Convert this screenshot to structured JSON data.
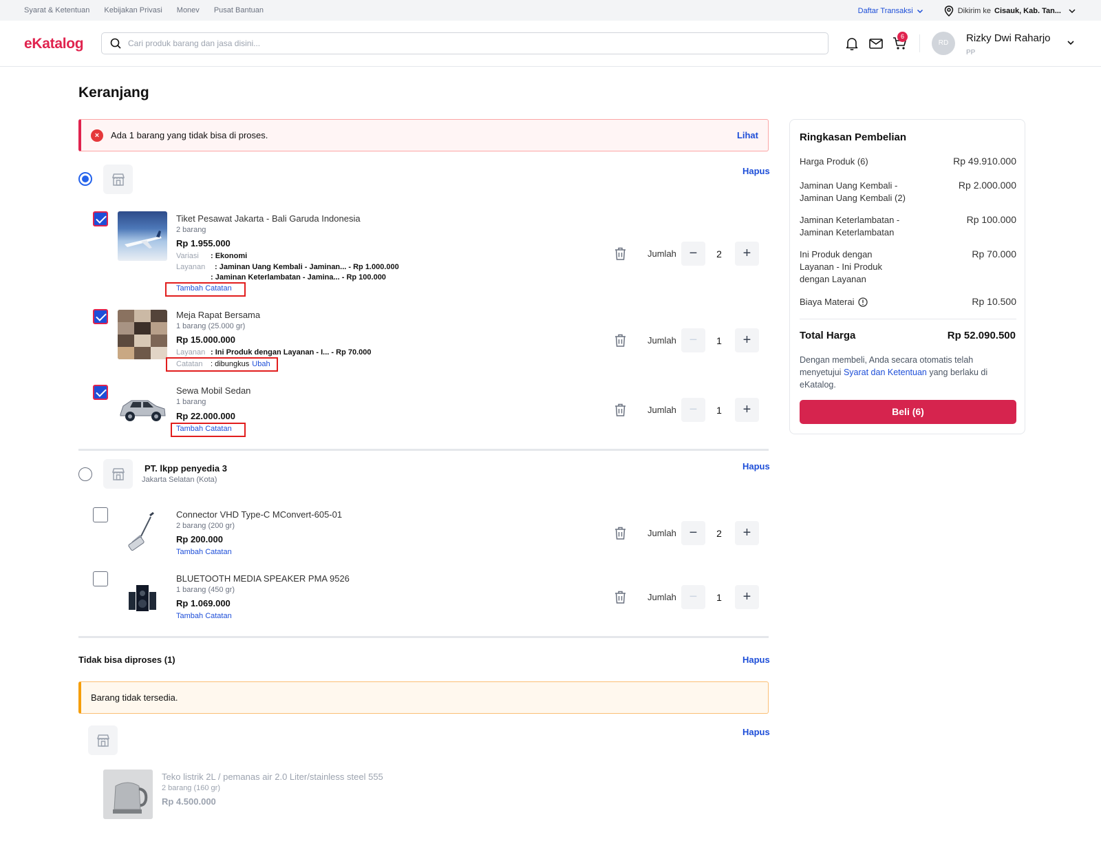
{
  "topbar": {
    "links": [
      "Syarat & Ketentuan",
      "Kebijakan Privasi",
      "Monev",
      "Pusat Bantuan"
    ],
    "daftar_transaksi": "Daftar Transaksi",
    "dikirim_label": "Dikirim ke",
    "dikirim_value": "Cisauk, Kab. Tan..."
  },
  "header": {
    "logo": "eKatalog",
    "search_placeholder": "Cari produk barang dan jasa disini...",
    "cart_count": "6",
    "avatar_initials": "RD",
    "user_name": "Rizky Dwi Raharjo",
    "user_role": "PP"
  },
  "page": {
    "title": "Keranjang",
    "alert_error": "Ada 1 barang yang tidak bisa di proses.",
    "alert_link": "Lihat",
    "hapus": "Hapus",
    "jumlah_label": "Jumlah"
  },
  "store1": {
    "items": [
      {
        "name": "Tiket Pesawat Jakarta - Bali Garuda Indonesia",
        "qty_text": "2 barang",
        "price": "Rp 1.955.000",
        "variasi_label": "Variasi",
        "variasi_value": ": Ekonomi",
        "layanan_label": "Layanan",
        "layanan_1": ": Jaminan Uang Kembali - Jaminan... - Rp 1.000.000",
        "layanan_2": ": Jaminan Keterlambatan - Jamina... - Rp 100.000",
        "note_link": "Tambah Catatan",
        "quantity": "2",
        "checked": true
      },
      {
        "name": "Meja Rapat Bersama",
        "qty_text": "1 barang (25.000 gr)",
        "price": "Rp 15.000.000",
        "layanan_label": "Layanan",
        "layanan_1": ": Ini Produk dengan Layanan - I... - Rp 70.000",
        "catatan_label": "Catatan",
        "catatan_value": ": dibungkus",
        "ubah_link": "Ubah",
        "quantity": "1",
        "checked": true
      },
      {
        "name": "Sewa Mobil Sedan",
        "qty_text": "1 barang",
        "price": "Rp 22.000.000",
        "note_link": "Tambah Catatan",
        "quantity": "1",
        "checked": true
      }
    ]
  },
  "store2": {
    "name": "PT. lkpp penyedia 3",
    "location": "Jakarta Selatan (Kota)",
    "items": [
      {
        "name": "Connector VHD Type-C MConvert-605-01",
        "qty_text": "2 barang (200 gr)",
        "price": "Rp 200.000",
        "note_link": "Tambah Catatan",
        "quantity": "2",
        "checked": false
      },
      {
        "name": "BLUETOOTH MEDIA SPEAKER PMA 9526",
        "qty_text": "1 barang (450 gr)",
        "price": "Rp 1.069.000",
        "note_link": "Tambah Catatan",
        "quantity": "1",
        "checked": false
      }
    ]
  },
  "unprocessable": {
    "title": "Tidak bisa diproses (1)",
    "alert": "Barang tidak tersedia.",
    "item": {
      "name": "Teko listrik 2L / pemanas air 2.0 Liter/stainless steel 555",
      "qty_text": "2 barang (160 gr)",
      "price": "Rp 4.500.000"
    }
  },
  "summary": {
    "title": "Ringkasan Pembelian",
    "rows": [
      {
        "label": "Harga Produk (6)",
        "value": "Rp 49.910.000"
      },
      {
        "label": "Jaminan Uang Kembali - Jaminan Uang Kembali (2)",
        "value": "Rp 2.000.000"
      },
      {
        "label": "Jaminan Keterlambatan - Jaminan Keterlambatan",
        "value": "Rp 100.000"
      },
      {
        "label": "Ini Produk dengan Layanan - Ini Produk dengan Layanan",
        "value": "Rp 70.000"
      },
      {
        "label": "Biaya Materai",
        "value": "Rp 10.500"
      }
    ],
    "total_label": "Total Harga",
    "total_value": "Rp 52.090.500",
    "terms_prefix": "Dengan membeli, Anda secara otomatis telah menyetujui",
    "terms_link": "Syarat dan Ketentuan",
    "terms_suffix": "yang berlaku di eKatalog.",
    "buy_button": "Beli (6)"
  },
  "colors": {
    "brand": "#e0234e",
    "link": "#1d4ed8",
    "buy": "#d6244e"
  }
}
